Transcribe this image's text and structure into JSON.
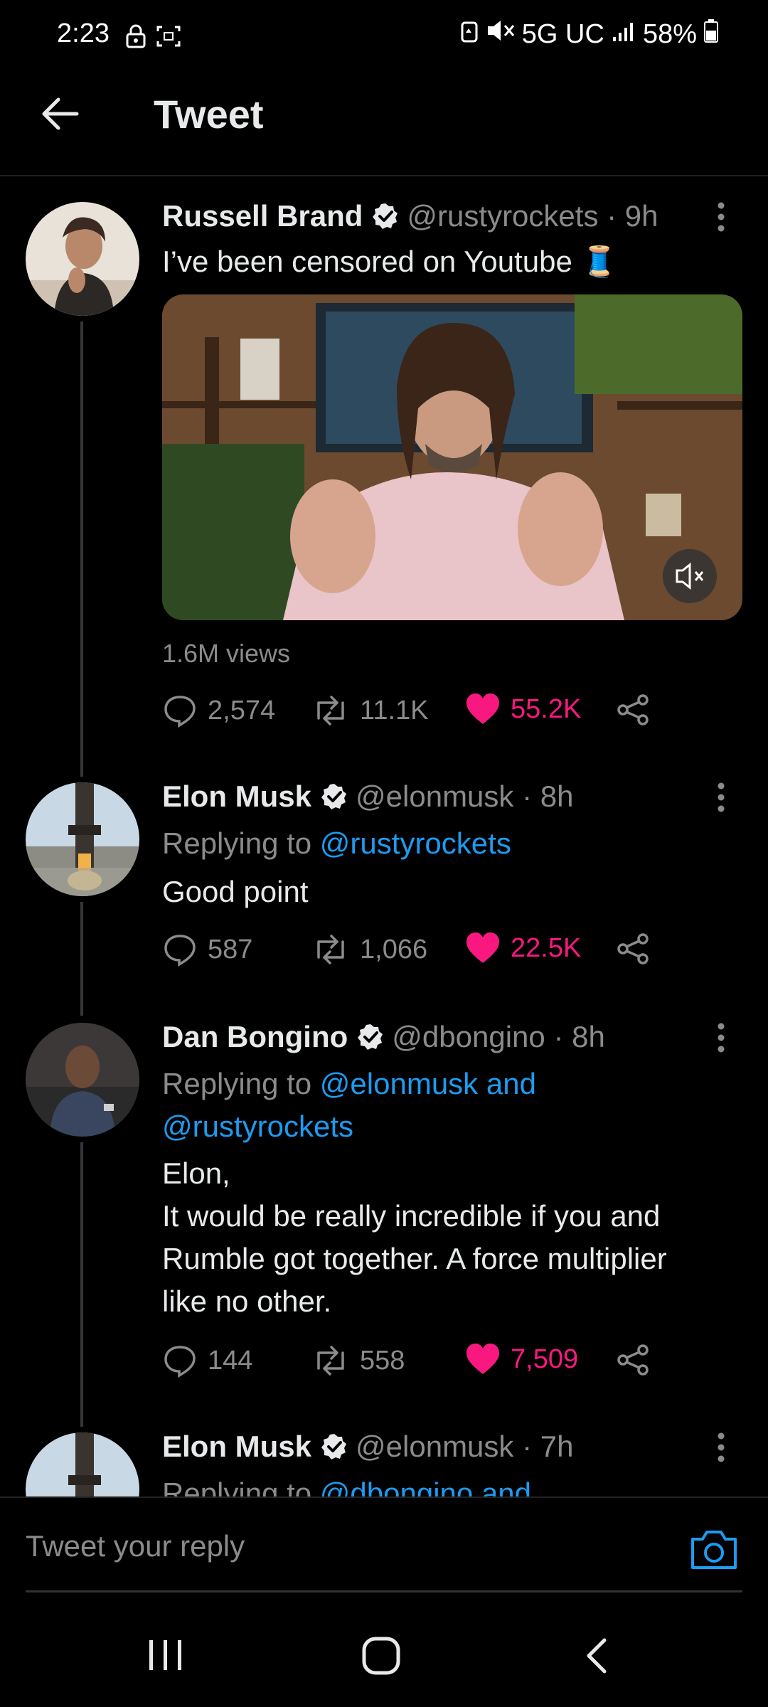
{
  "status": {
    "time": "2:23",
    "network": "5G UC",
    "battery": "58%"
  },
  "header": {
    "title": "Tweet"
  },
  "tweets": [
    {
      "name": "Russell Brand",
      "handle": "@rustyrockets",
      "time": "9h",
      "text": "I’ve been censored on Youtube 🧵",
      "views": "1.6M views",
      "replies": "2,574",
      "retweets": "11.1K",
      "likes": "55.2K"
    },
    {
      "name": "Elon Musk",
      "handle": "@elonmusk",
      "time": "8h",
      "replying_label": "Replying to ",
      "replying_to": "@rustyrockets",
      "text": "Good point",
      "replies": "587",
      "retweets": "1,066",
      "likes": "22.5K"
    },
    {
      "name": "Dan Bongino",
      "handle": "@dbongino",
      "time": "8h",
      "replying_label": "Replying to ",
      "replying_to_line1": "@elonmusk and",
      "replying_to_line2": "@rustyrockets",
      "text_lines": [
        "Elon,",
        "It would be really incredible if you and",
        "Rumble got together. A force multiplier",
        "like no other."
      ],
      "replies": "144",
      "retweets": "558",
      "likes": "7,509"
    },
    {
      "name": "Elon Musk",
      "handle": "@elonmusk",
      "time": "7h",
      "replying_label": "Replying to ",
      "replying_to": "@dbongino and"
    }
  ],
  "reply": {
    "placeholder": "Tweet your reply"
  },
  "colors": {
    "accent": "#1d9bf0",
    "like": "#f91880",
    "muted": "#8b8b8b"
  }
}
